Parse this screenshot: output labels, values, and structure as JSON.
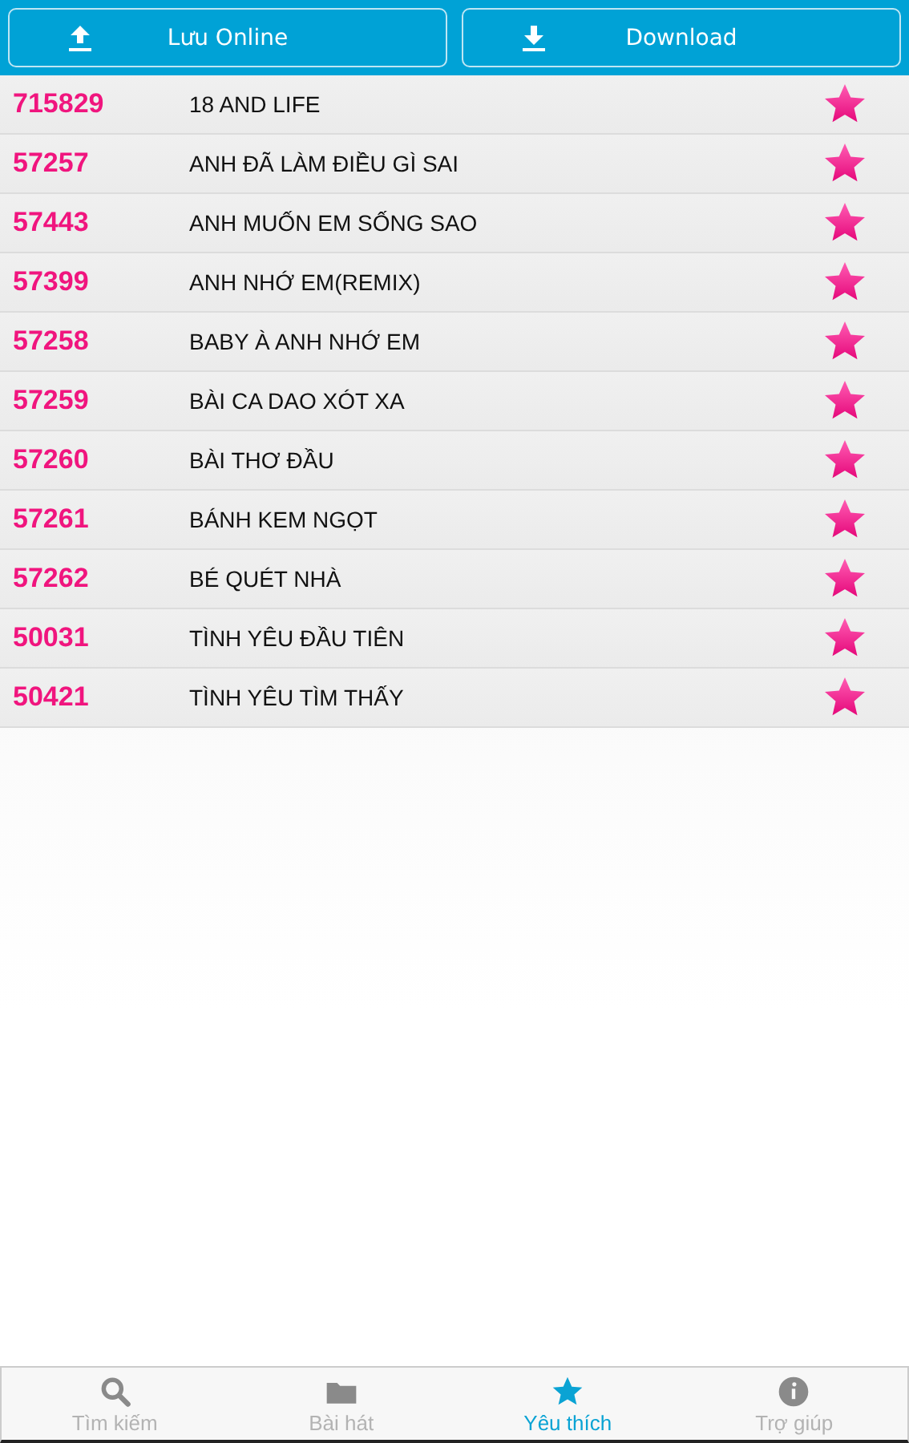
{
  "actions": [
    {
      "kind": "upload",
      "label": "Lưu Online"
    },
    {
      "kind": "download",
      "label": "Download"
    }
  ],
  "songs": [
    {
      "code": "715829",
      "title": "18 AND LIFE",
      "favorite": true
    },
    {
      "code": "57257",
      "title": "ANH ĐÃ LÀM ĐIỀU GÌ SAI",
      "favorite": true
    },
    {
      "code": "57443",
      "title": "ANH MUỐN EM SỐNG SAO",
      "favorite": true
    },
    {
      "code": "57399",
      "title": "ANH NHỚ EM(REMIX)",
      "favorite": true
    },
    {
      "code": "57258",
      "title": "BABY À ANH NHỚ EM",
      "favorite": true
    },
    {
      "code": "57259",
      "title": "BÀI CA DAO XÓT XA",
      "favorite": true
    },
    {
      "code": "57260",
      "title": "BÀI THƠ ĐẦU",
      "favorite": true
    },
    {
      "code": "57261",
      "title": "BÁNH KEM NGỌT",
      "favorite": true
    },
    {
      "code": "57262",
      "title": "BÉ QUÉT NHÀ",
      "favorite": true
    },
    {
      "code": "50031",
      "title": "TÌNH YÊU ĐẦU TIÊN",
      "favorite": true
    },
    {
      "code": "50421",
      "title": "TÌNH YÊU TÌM THẤY",
      "favorite": true
    }
  ],
  "tabs": [
    {
      "kind": "search",
      "label": "Tìm kiếm",
      "selected": false
    },
    {
      "kind": "folder",
      "label": "Bài hát",
      "selected": false
    },
    {
      "kind": "star",
      "label": "Yêu thích",
      "selected": true
    },
    {
      "kind": "info",
      "label": "Trợ giúp",
      "selected": false
    }
  ]
}
